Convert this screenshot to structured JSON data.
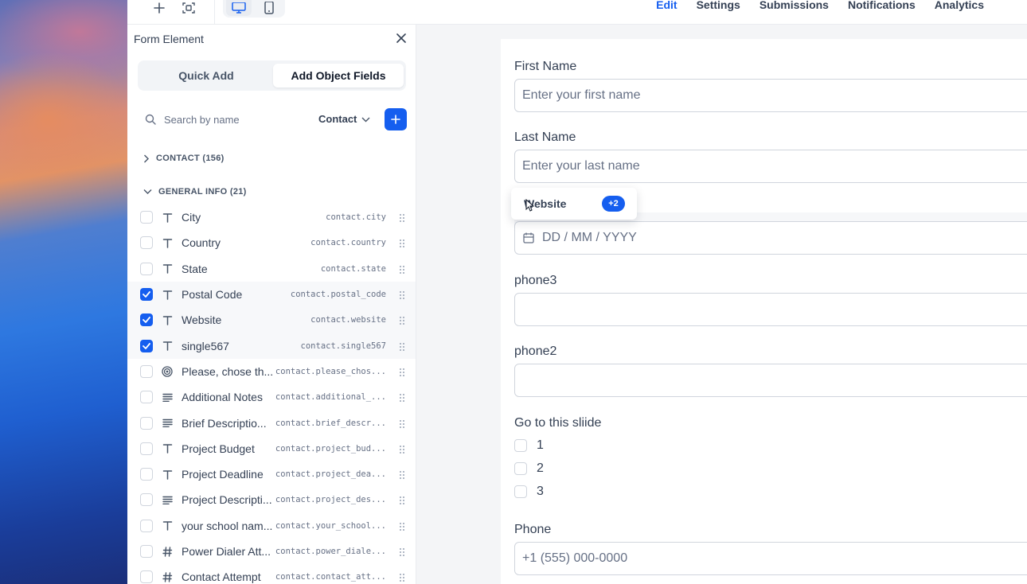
{
  "topbar": {
    "nav": [
      {
        "label": "Edit",
        "active": true
      },
      {
        "label": "Settings",
        "active": false
      },
      {
        "label": "Submissions",
        "active": false
      },
      {
        "label": "Notifications",
        "active": false
      },
      {
        "label": "Analytics",
        "active": false
      }
    ],
    "icons": [
      "plus-icon",
      "scan-icon",
      "desktop-icon",
      "mobile-icon"
    ]
  },
  "panel": {
    "title": "Form Element",
    "tabs": [
      {
        "label": "Quick Add",
        "active": false
      },
      {
        "label": "Add Object Fields",
        "active": true
      }
    ],
    "search": {
      "placeholder": "Search by name",
      "value": ""
    },
    "object_select": "Contact",
    "groups": [
      {
        "label": "CONTACT (156)",
        "expanded": false
      },
      {
        "label": "GENERAL INFO (21)",
        "expanded": true
      }
    ],
    "fields": [
      {
        "type": "text",
        "name": "City",
        "key": "contact.city",
        "checked": false
      },
      {
        "type": "text",
        "name": "Country",
        "key": "contact.country",
        "checked": false
      },
      {
        "type": "text",
        "name": "State",
        "key": "contact.state",
        "checked": false
      },
      {
        "type": "text",
        "name": "Postal Code",
        "key": "contact.postal_code",
        "checked": true
      },
      {
        "type": "text",
        "name": "Website",
        "key": "contact.website",
        "checked": true
      },
      {
        "type": "text",
        "name": "single567",
        "key": "contact.single567",
        "checked": true
      },
      {
        "type": "radio",
        "name": "Please, chose th...",
        "key": "contact.please_chos...",
        "checked": false
      },
      {
        "type": "textarea",
        "name": "Additional Notes",
        "key": "contact.additional_...",
        "checked": false
      },
      {
        "type": "textarea",
        "name": "Brief Descriptio...",
        "key": "contact.brief_descr...",
        "checked": false
      },
      {
        "type": "text",
        "name": "Project Budget",
        "key": "contact.project_bud...",
        "checked": false
      },
      {
        "type": "text",
        "name": "Project Deadline",
        "key": "contact.project_dea...",
        "checked": false
      },
      {
        "type": "textarea",
        "name": "Project Descripti...",
        "key": "contact.project_des...",
        "checked": false
      },
      {
        "type": "text",
        "name": "your school nam...",
        "key": "contact.your_school...",
        "checked": false
      },
      {
        "type": "number",
        "name": "Power Dialer Att...",
        "key": "contact.power_diale...",
        "checked": false
      },
      {
        "type": "number",
        "name": "Contact Attempt",
        "key": "contact.contact_att...",
        "checked": false
      }
    ]
  },
  "form": {
    "first_name": {
      "label": "First Name",
      "placeholder": "Enter your first name"
    },
    "last_name": {
      "label": "Last Name",
      "placeholder": "Enter your last name"
    },
    "date": {
      "placeholder": "DD / MM / YYYY"
    },
    "phone3": {
      "label": "phone3"
    },
    "phone2": {
      "label": "phone2"
    },
    "slide": {
      "label": "Go to this sliide",
      "options": [
        "1",
        "2",
        "3"
      ]
    },
    "phone": {
      "label": "Phone",
      "placeholder": "+1 (555) 000-0000"
    }
  },
  "drag_chip": {
    "label": "Website",
    "badge": "+2"
  },
  "colors": {
    "accent": "#155eef",
    "text": "#344054",
    "border": "#d0d5dd"
  }
}
